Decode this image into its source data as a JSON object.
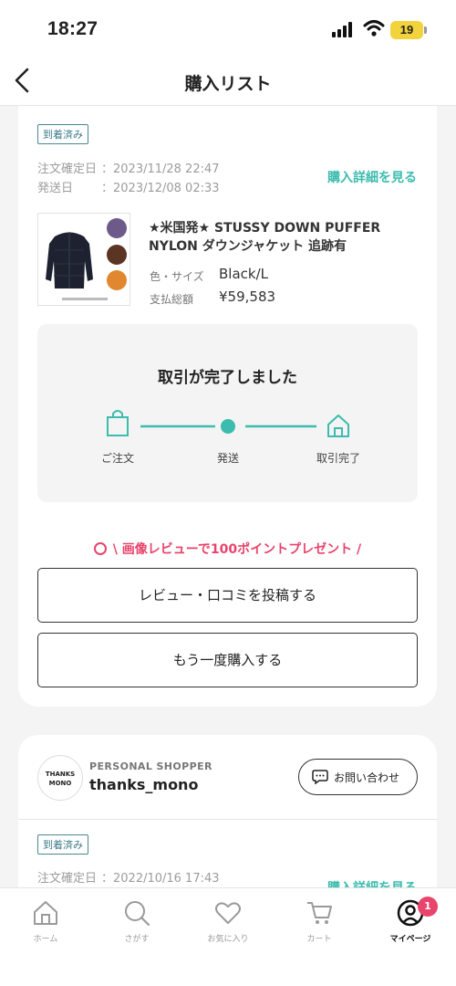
{
  "status_bar": {
    "time": "18:27",
    "battery": "19"
  },
  "header": {
    "title": "購入リスト"
  },
  "orders": [
    {
      "status_badge": "到着済み",
      "order_date_label": "注文確定日",
      "order_date": "：2023/11/28 22:47",
      "ship_date_label": "発送日",
      "ship_date": "：2023/12/08 02:33",
      "detail_link": "購入詳細を見る",
      "product_title": "★米国発★ STUSSY DOWN PUFFER NYLON ダウンジャケット 追跡有",
      "spec_label": "色・サイズ",
      "spec_value": "Black/L",
      "total_label": "支払総額",
      "total_value": "¥59,583",
      "progress_title": "取引が完了しました",
      "steps": [
        "ご注文",
        "発送",
        "取引完了"
      ],
      "promo": "\\ 画像レビューで100ポイントプレゼント /",
      "review_button": "レビュー・口コミを投稿する",
      "rebuy_button": "もう一度購入する"
    },
    {
      "shop_type": "PERSONAL SHOPPER",
      "shop_name": "thanks_mono",
      "shop_logo_line1": "THANKS",
      "shop_logo_line2": "MONO",
      "contact_button": "お問い合わせ",
      "status_badge": "到着済み",
      "order_date_label": "注文確定日",
      "order_date": "：2022/10/16 17:43",
      "detail_link": "購入詳細を見る"
    }
  ],
  "tabs": [
    {
      "label": "ホーム",
      "icon": "home-icon"
    },
    {
      "label": "さがす",
      "icon": "search-icon"
    },
    {
      "label": "お気に入り",
      "icon": "heart-icon"
    },
    {
      "label": "カート",
      "icon": "cart-icon"
    },
    {
      "label": "マイページ",
      "icon": "mypage-icon",
      "badge": "1",
      "active": true
    }
  ],
  "colors": {
    "accent": "#3cbcae",
    "promo": "#e8446c",
    "badge_border": "#4a8794"
  }
}
